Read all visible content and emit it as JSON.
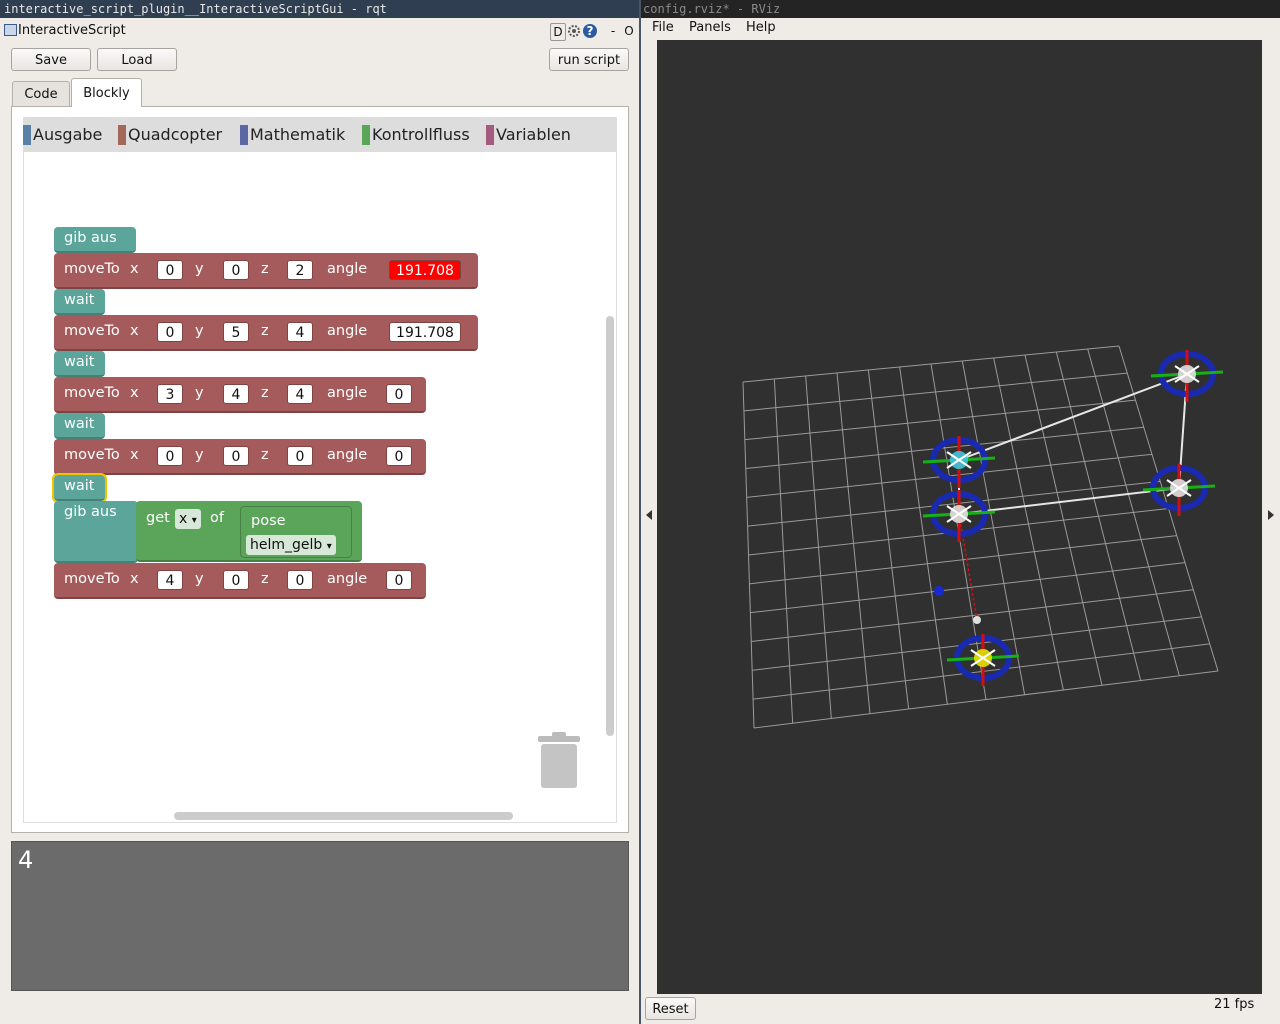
{
  "left_window": {
    "title": "interactive_script_plugin__InteractiveScriptGui - rqt",
    "plugin_name": "InteractiveScript",
    "header_buttons": {
      "d": "D",
      "help": "?",
      "minimize": "-",
      "close": "O"
    },
    "toolbar": {
      "save_label": "Save",
      "load_label": "Load",
      "run_label": "run script"
    },
    "tabs": [
      {
        "label": "Code"
      },
      {
        "label": "Blockly"
      }
    ],
    "active_tab": "Blockly",
    "toolbox": [
      {
        "label": "Ausgabe",
        "color": "#5b80a5"
      },
      {
        "label": "Quadcopter",
        "color": "#a5675b"
      },
      {
        "label": "Mathematik",
        "color": "#5b67a5"
      },
      {
        "label": "Kontrollfluss",
        "color": "#5ba55b"
      },
      {
        "label": "Variablen",
        "color": "#a55b80"
      }
    ],
    "blocks": {
      "gib_aus": "gib aus",
      "move_to": "moveTo",
      "wait": "wait",
      "x": "x",
      "y": "y",
      "z": "z",
      "angle": "angle",
      "get": "get",
      "of": "of",
      "pose": "pose",
      "get_field": "x",
      "object": "helm_gelb",
      "moves": [
        {
          "x": "0",
          "y": "0",
          "z": "2",
          "angle": "191.708"
        },
        {
          "x": "0",
          "y": "5",
          "z": "4",
          "angle": "191.708"
        },
        {
          "x": "3",
          "y": "4",
          "z": "4",
          "angle": "0"
        },
        {
          "x": "0",
          "y": "0",
          "z": "0",
          "angle": "0"
        },
        {
          "x": "4",
          "y": "0",
          "z": "0",
          "angle": "0"
        }
      ]
    },
    "console_output": "4"
  },
  "right_window": {
    "title": "config.rviz* - RViz",
    "menu": [
      {
        "label": "File"
      },
      {
        "label": "Panels"
      },
      {
        "label": "Help"
      }
    ],
    "reset_label": "Reset",
    "fps": "21 fps"
  }
}
